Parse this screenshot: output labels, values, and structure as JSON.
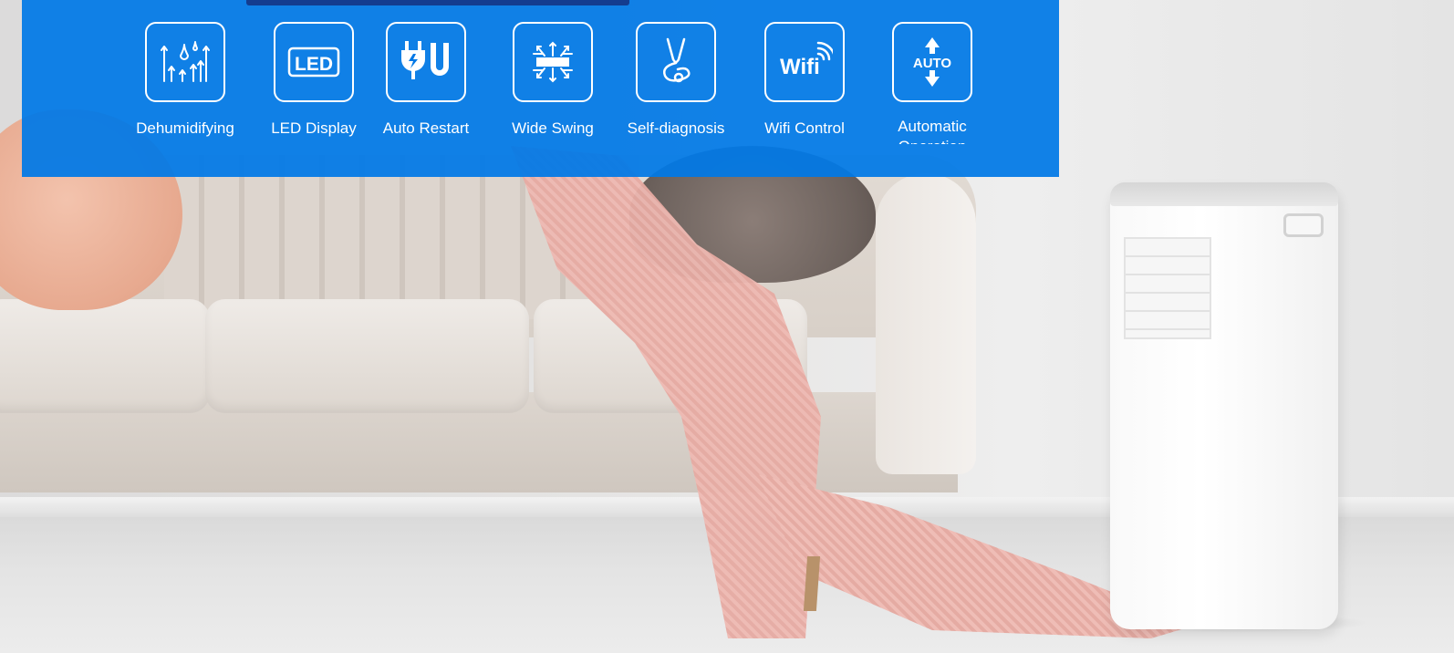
{
  "colors": {
    "banner_blue": "#0078e6",
    "banner_top_strip": "#143c8f",
    "text": "#ffffff"
  },
  "features": [
    {
      "label": "Dehumidifying",
      "icon": "dehumidify-icon"
    },
    {
      "label": "LED Display",
      "icon": "led-icon",
      "icon_text": "LED"
    },
    {
      "label": "Auto Restart",
      "icon": "plug-restart-icon"
    },
    {
      "label": "Wide Swing",
      "icon": "wide-swing-icon"
    },
    {
      "label": "Self-diagnosis",
      "icon": "stethoscope-icon"
    },
    {
      "label": "Wifi Control",
      "icon": "wifi-icon",
      "icon_text": "Wifi"
    },
    {
      "label": "Automatic Operation",
      "icon": "auto-icon",
      "icon_text": "AUTO"
    }
  ]
}
